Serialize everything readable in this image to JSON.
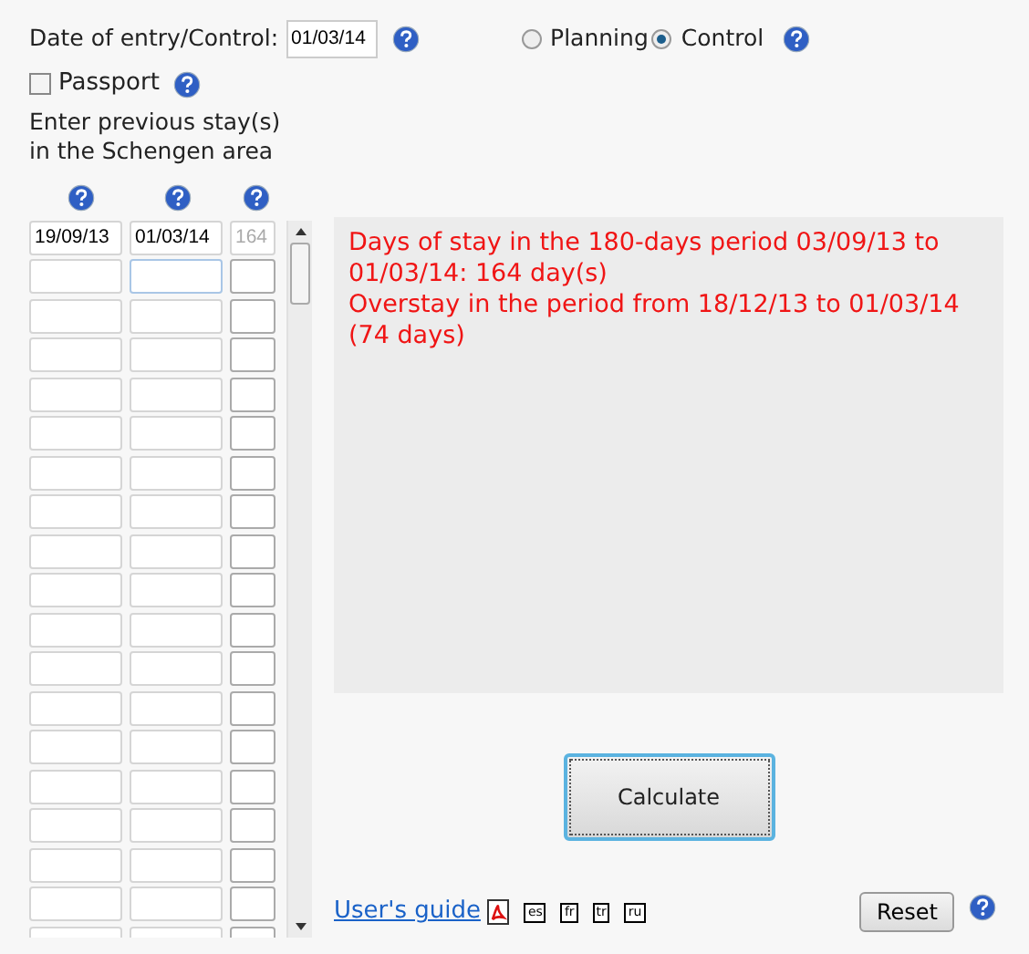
{
  "date_field": {
    "label": "Date of entry/Control:",
    "value": "01/03/14"
  },
  "modes": [
    {
      "label": "Planning",
      "selected": false
    },
    {
      "label": "Control",
      "selected": true
    }
  ],
  "passport": {
    "label": "Passport",
    "checked": false
  },
  "stays_heading": "Enter previous stay(s) in the Schengen area",
  "stays": [
    {
      "entry": "19/09/13",
      "exit": "01/03/14",
      "days": "164"
    }
  ],
  "result_lines": [
    "Days of stay in the 180-days period 03/09/13 to 01/03/14: 164 day(s)",
    "Overstay in the period from 18/12/13 to 01/03/14 (74 days)"
  ],
  "calculate_button": "Calculate",
  "guide_link": "User's guide",
  "languages": [
    "es",
    "fr",
    "tr",
    "ru"
  ],
  "reset_button": "Reset"
}
